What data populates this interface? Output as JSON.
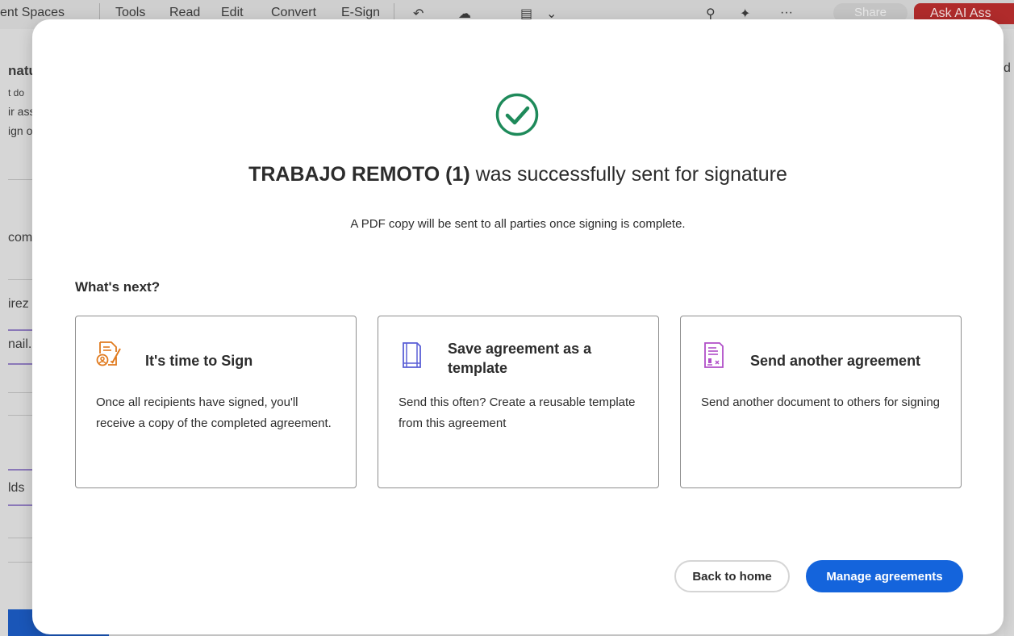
{
  "background": {
    "toolbar": {
      "items": [
        "ent Spaces",
        "Tools",
        "Read",
        "Edit",
        "Convert",
        "E-Sign"
      ],
      "share_label": "Share",
      "ask_ai_label": "Ask AI Ass",
      "icons": [
        "undo-icon",
        "cloud-icon",
        "page-icon",
        "chevron-down-icon",
        "search-icon",
        "ai-assistant-icon",
        "more-icon"
      ],
      "more_glyph": "···"
    },
    "left_panel": {
      "texts": [
        "natu",
        "t do",
        "ir ass",
        "ign o",
        "com",
        "irez",
        "nail.c",
        "lds"
      ]
    },
    "right_panel_text": "d"
  },
  "dialog": {
    "title_strong": "TRABAJO REMOTO (1)",
    "title_rest": " was successfully sent for signature",
    "subtitle": "A PDF copy will be sent to all parties once signing is complete.",
    "next_heading": "What's next?",
    "cards": [
      {
        "title": "It's time to Sign",
        "description": "Once all recipients have signed, you'll receive a copy of the completed agreement.",
        "icon": "sign-document-icon"
      },
      {
        "title": "Save agreement as a template",
        "description": "Send this often? Create a reusable template from this agreement",
        "icon": "template-icon"
      },
      {
        "title": "Send another agreement",
        "description": "Send another document to others for signing",
        "icon": "send-document-icon"
      }
    ],
    "buttons": {
      "back": "Back to home",
      "manage": "Manage agreements"
    }
  },
  "colors": {
    "success_green": "#1e8a5a",
    "primary_blue": "#1464dc",
    "sign_orange": "#e07a1e",
    "template_blue": "#5a5fd6",
    "send_purple": "#b04fc8"
  }
}
